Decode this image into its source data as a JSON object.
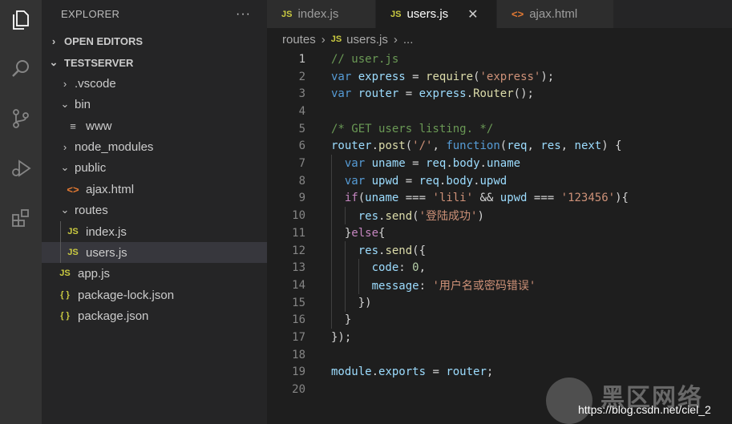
{
  "activity_bar": {
    "icons": [
      "files-icon",
      "search-icon",
      "source-control-icon",
      "run-debug-icon",
      "extensions-icon"
    ]
  },
  "sidebar": {
    "title": "EXPLORER",
    "more": "···",
    "open_editors": "OPEN EDITORS",
    "workspace": "TESTSERVER",
    "tree": [
      {
        "label": ".vscode",
        "icon": "chevron-right"
      },
      {
        "label": "bin",
        "icon": "chevron-down"
      },
      {
        "label": "www",
        "icon": "file-lines"
      },
      {
        "label": "node_modules",
        "icon": "chevron-right"
      },
      {
        "label": "public",
        "icon": "chevron-down"
      },
      {
        "label": "ajax.html",
        "icon": "html"
      },
      {
        "label": "routes",
        "icon": "chevron-down"
      },
      {
        "label": "index.js",
        "icon": "js"
      },
      {
        "label": "users.js",
        "icon": "js"
      },
      {
        "label": "app.js",
        "icon": "js"
      },
      {
        "label": "package-lock.json",
        "icon": "json"
      },
      {
        "label": "package.json",
        "icon": "json"
      }
    ],
    "js_badge": "JS",
    "json_badge": "{ }",
    "html_badge": "<>"
  },
  "tabs": [
    {
      "label": "index.js",
      "icon": "JS",
      "active": false
    },
    {
      "label": "users.js",
      "icon": "JS",
      "active": true,
      "close": "✕"
    },
    {
      "label": "ajax.html",
      "icon": "<>",
      "active": false
    }
  ],
  "breadcrumb": {
    "folder": "routes",
    "file": "users.js",
    "more": "..."
  },
  "code_lines": [
    "1",
    "2",
    "3",
    "4",
    "5",
    "6",
    "7",
    "8",
    "9",
    "10",
    "11",
    "12",
    "13",
    "14",
    "15",
    "16",
    "17",
    "18",
    "19",
    "20"
  ],
  "watermark": {
    "title": "黑区网络",
    "url": "https://blog.csdn.net/ciel_2"
  }
}
